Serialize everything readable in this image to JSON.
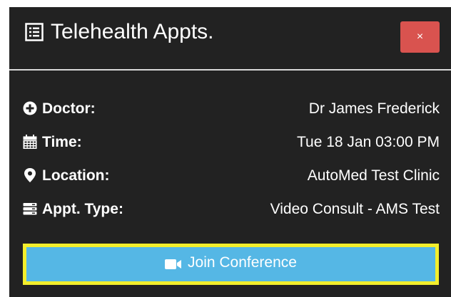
{
  "header": {
    "title": "Telehealth Appts.",
    "title_icon": "list-icon",
    "close_label": "×"
  },
  "details": [
    {
      "icon": "plus-circle-icon",
      "label": "Doctor:",
      "value": "Dr James Frederick"
    },
    {
      "icon": "calendar-icon",
      "label": "Time:",
      "value": "Tue 18 Jan 03:00 PM"
    },
    {
      "icon": "map-marker-icon",
      "label": "Location:",
      "value": "AutoMed Test Clinic"
    },
    {
      "icon": "server-icon",
      "label": "Appt. Type:",
      "value": "Video Consult - AMS Test"
    }
  ],
  "join_button": {
    "label": "Join Conference",
    "icon": "video-camera-icon"
  },
  "colors": {
    "panel_bg": "#222222",
    "close_bg": "#d9534f",
    "join_bg": "#55b7e5",
    "focus_outline": "#f3ee2c",
    "divider": "#d8d8d8"
  }
}
